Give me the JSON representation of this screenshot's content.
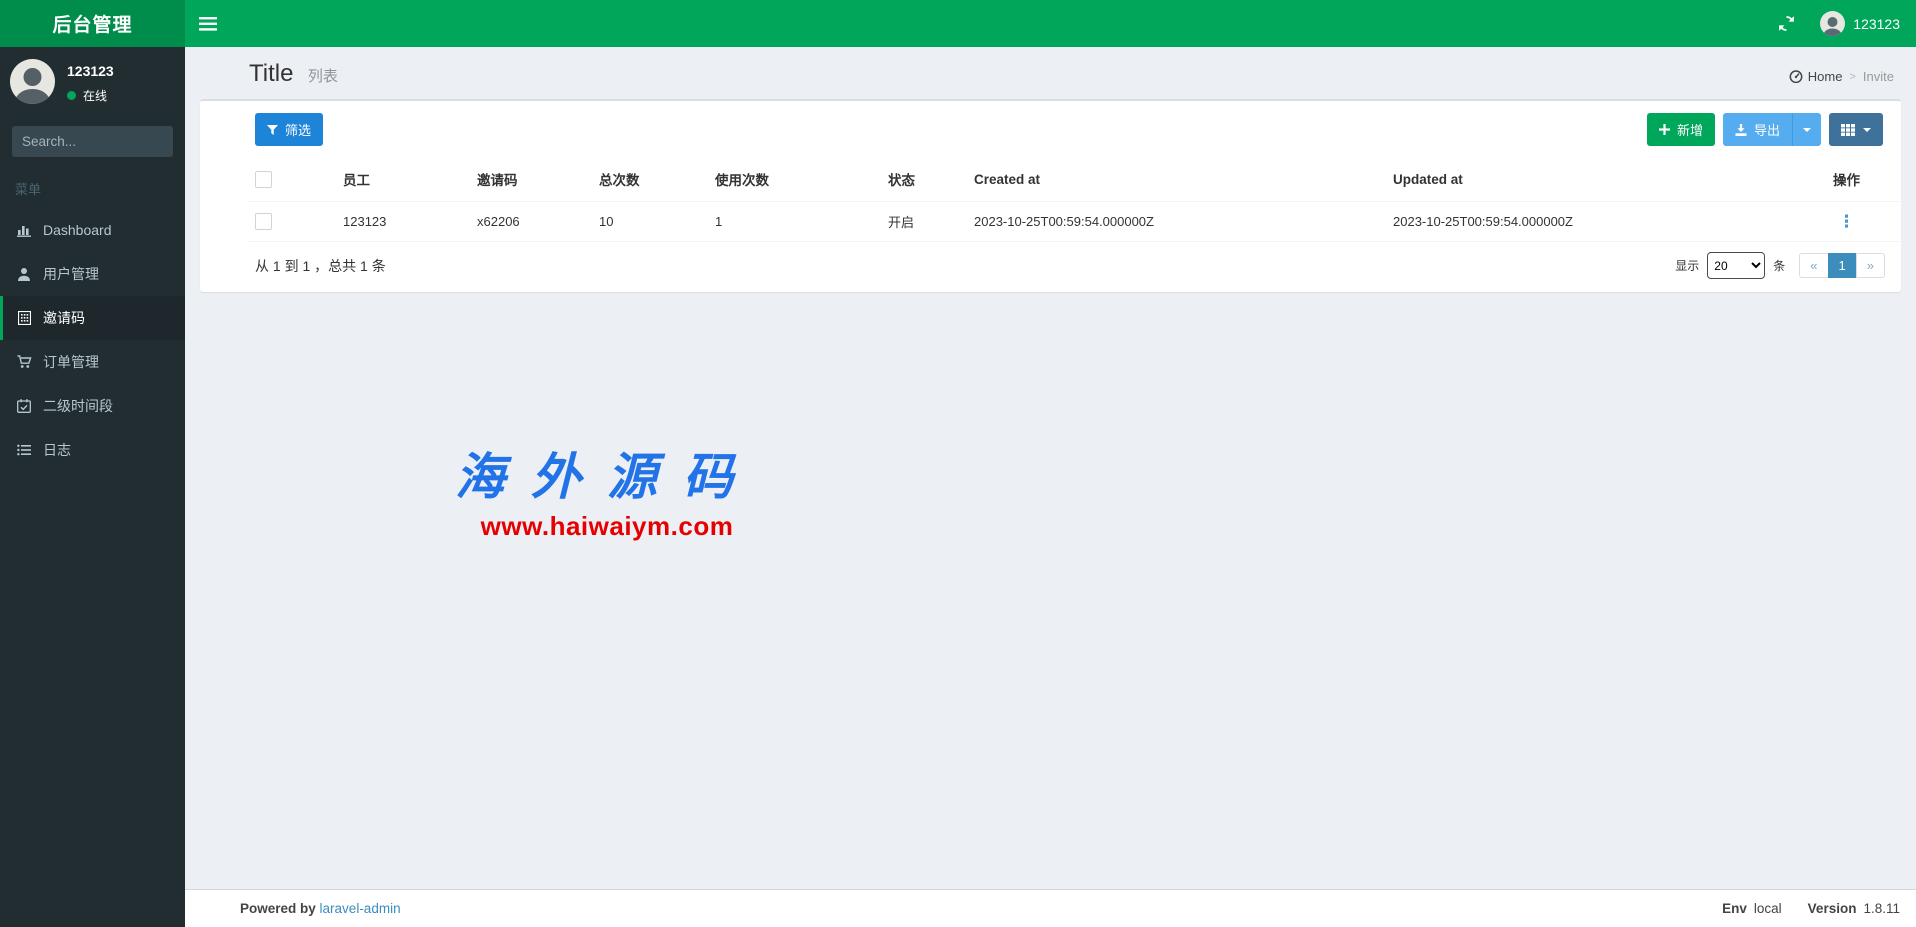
{
  "topbar": {
    "brand": "后台管理",
    "username": "123123"
  },
  "sidebar": {
    "user_name": "123123",
    "user_status": "在线",
    "search_placeholder": "Search...",
    "section_label": "菜单",
    "items": [
      {
        "label": "Dashboard",
        "icon": "chart-bar-icon",
        "active": false
      },
      {
        "label": "用户管理",
        "icon": "user-icon",
        "active": false
      },
      {
        "label": "邀请码",
        "icon": "qrcode-icon",
        "active": true
      },
      {
        "label": "订单管理",
        "icon": "shopping-cart-icon",
        "active": false
      },
      {
        "label": "二级时间段",
        "icon": "calendar-check-icon",
        "active": false
      },
      {
        "label": "日志",
        "icon": "list-icon",
        "active": false
      }
    ]
  },
  "page": {
    "title": "Title",
    "subtitle": "列表"
  },
  "breadcrumb": {
    "home": "Home",
    "separator": ">",
    "current": "Invite"
  },
  "toolbar": {
    "filter": "筛选",
    "create": "新增",
    "export": "导出"
  },
  "grid": {
    "headers": {
      "staff": "员工",
      "code": "邀请码",
      "total": "总次数",
      "used": "使用次数",
      "status": "状态",
      "created": "Created at",
      "updated": "Updated at",
      "actions": "操作"
    },
    "rows": [
      {
        "staff": "123123",
        "code": "x62206",
        "total": "10",
        "used": "1",
        "status": "开启",
        "created": "2023-10-25T00:59:54.000000Z",
        "updated": "2023-10-25T00:59:54.000000Z"
      }
    ]
  },
  "pagination": {
    "summary": "从 1 到 1 ，总共 1 条",
    "show_label": "显示",
    "per_page": "20",
    "unit_label": "条",
    "prev": "«",
    "current_page": "1",
    "next": "»"
  },
  "watermark": {
    "title": "海外源码",
    "url": "www.haiwaiym.com"
  },
  "footer": {
    "powered_prefix": "Powered by",
    "powered_link": "laravel-admin",
    "env_label": "Env",
    "env_value": "local",
    "version_label": "Version",
    "version_value": "1.8.11"
  },
  "icons": {
    "hamburger-icon": "≡",
    "refresh-icon": "⟳",
    "search-icon": "🔍",
    "filter-icon": "funnel",
    "plus-icon": "+",
    "download-icon": "⤓",
    "table-grid-icon": "▦",
    "caret-down-icon": "▾",
    "dashboard-gauge-icon": "gauge",
    "actions-ellipsis-icon": "⋮",
    "online-dot-icon": "●"
  },
  "colors": {
    "logo-green": "#008d4c",
    "navbar-green": "#00a65a",
    "sidebar-dark": "#222d32",
    "sidebar-active": "#1e282c",
    "filter-blue": "#1d84d8",
    "create-green": "#00a65a",
    "export-blue": "#55acee",
    "grid-slate": "#3f729b",
    "page-active-blue": "#3c8dbc",
    "link-blue": "#3c8dbc",
    "watermark-blue": "#2273e8",
    "watermark-red": "#e60000",
    "status-online-green": "#00a65a"
  }
}
